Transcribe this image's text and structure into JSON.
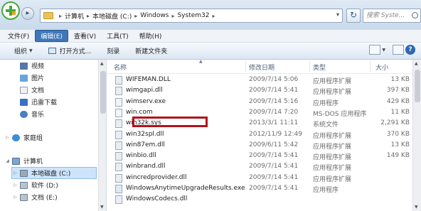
{
  "address": {
    "crumbs": [
      "计算机",
      "本地磁盘 (C:)",
      "Windows",
      "System32"
    ],
    "search_placeholder": "搜索 Syste..."
  },
  "menu": [
    {
      "label": "文件(F)",
      "active": false
    },
    {
      "label": "编辑(E)",
      "active": true
    },
    {
      "label": "查看(V)",
      "active": false
    },
    {
      "label": "工具(T)",
      "active": false
    },
    {
      "label": "帮助(H)",
      "active": false
    }
  ],
  "toolbar": {
    "organize": "组织",
    "open_with": "打开方式...",
    "burn": "刻录",
    "new_folder": "新建文件夹"
  },
  "nav": {
    "libraries": [
      {
        "label": "视频",
        "icon": "video-icon"
      },
      {
        "label": "图片",
        "icon": "image-icon"
      },
      {
        "label": "文档",
        "icon": "document-icon"
      },
      {
        "label": "迅雷下载",
        "icon": "thunder-download-icon"
      },
      {
        "label": "音乐",
        "icon": "music-icon"
      }
    ],
    "homegroup": "家庭组",
    "computer": "计算机",
    "drives": [
      {
        "label": "本地磁盘 (C:)",
        "selected": true
      },
      {
        "label": "软件 (D:)",
        "selected": false
      },
      {
        "label": "文档 (E:)",
        "selected": false
      }
    ]
  },
  "columns": {
    "name": "名称",
    "date": "修改日期",
    "type": "类型",
    "size": "大小"
  },
  "files": [
    {
      "name": "WIFEMAN.DLL",
      "date": "2009/7/14 5:06",
      "type": "应用程序扩展",
      "size": "13 KB",
      "highlighted": false
    },
    {
      "name": "wimgapi.dll",
      "date": "2009/7/14 5:41",
      "type": "应用程序扩展",
      "size": "397 KB",
      "highlighted": false
    },
    {
      "name": "wimserv.exe",
      "date": "2009/7/14 5:16",
      "type": "应用程序",
      "size": "429 KB",
      "highlighted": false
    },
    {
      "name": "win.com",
      "date": "2009/7/14 7:20",
      "type": "MS-DOS 应用程序",
      "size": "11 KB",
      "highlighted": false
    },
    {
      "name": "win32k.sys",
      "date": "2013/3/1 11:11",
      "type": "系统文件",
      "size": "2,291 KB",
      "highlighted": true
    },
    {
      "name": "win32spl.dll",
      "date": "2012/11/9 12:49",
      "type": "应用程序扩展",
      "size": "370 KB",
      "highlighted": false
    },
    {
      "name": "win87em.dll",
      "date": "2009/6/11 5:42",
      "type": "应用程序扩展",
      "size": "13 KB",
      "highlighted": false
    },
    {
      "name": "winbio.dll",
      "date": "2009/7/14 5:41",
      "type": "应用程序扩展",
      "size": "149 KB",
      "highlighted": false
    },
    {
      "name": "winbrand.dll",
      "date": "2009/7/14 5:41",
      "type": "应用程序扩展",
      "size": "",
      "highlighted": false
    },
    {
      "name": "wincredprovider.dll",
      "date": "2009/7/14 5:41",
      "type": "应用程序扩展",
      "size": "",
      "highlighted": false
    },
    {
      "name": "WindowsAnytimeUpgradeResults.exe",
      "date": "2009/7/14 5:41",
      "type": "应用程序",
      "size": "",
      "highlighted": false
    },
    {
      "name": "WindowsCodecs.dll",
      "date": "",
      "type": "",
      "size": "",
      "highlighted": false
    }
  ],
  "colors": {
    "highlight_border": "#b4121b",
    "menu_active_bg": "#3f77b8",
    "selected_nav_bg": "#cde4fb"
  }
}
